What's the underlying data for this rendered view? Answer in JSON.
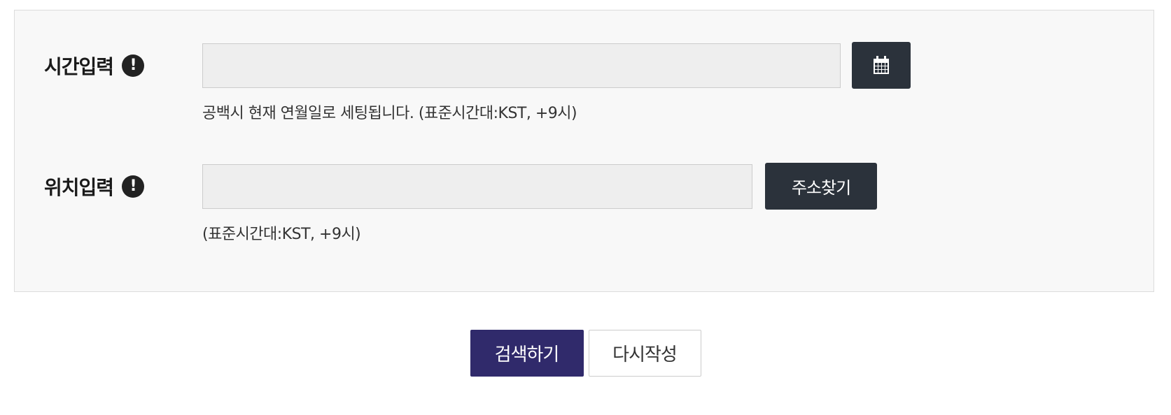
{
  "form": {
    "time": {
      "label": "시간입력",
      "warning_icon": "exclamation-circle-icon",
      "value": "",
      "calendar_icon": "calendar-icon",
      "hint": "공백시 현재 연월일로 세팅됩니다. (표준시간대:KST, +9시)"
    },
    "location": {
      "label": "위치입력",
      "warning_icon": "exclamation-circle-icon",
      "value": "",
      "address_button": "주소찾기",
      "hint": "(표준시간대:KST, +9시)"
    }
  },
  "actions": {
    "search_label": "검색하기",
    "reset_label": "다시작성"
  },
  "colors": {
    "panel_bg": "#f8f8f8",
    "dark_button": "#2b323b",
    "primary_button": "#302a6b"
  }
}
